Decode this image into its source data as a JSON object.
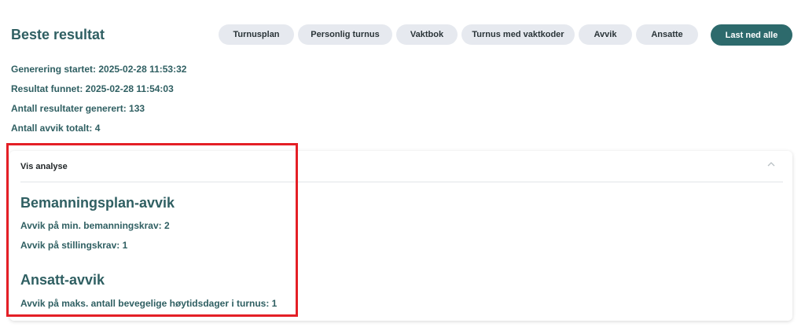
{
  "page_title": "Beste resultat",
  "tabs": [
    {
      "label": "Turnusplan"
    },
    {
      "label": "Personlig turnus"
    },
    {
      "label": "Vaktbok"
    },
    {
      "label": "Turnus med vaktkoder"
    },
    {
      "label": "Avvik"
    },
    {
      "label": "Ansatte"
    }
  ],
  "download_all_label": "Last ned alle",
  "info": {
    "generation_started": "Generering startet: 2025-02-28 11:53:32",
    "result_found": "Resultat funnet: 2025-02-28 11:54:03",
    "results_generated": "Antall resultater generert: 133",
    "total_deviations": "Antall avvik totalt: 4"
  },
  "analysis": {
    "toggle_label": "Vis analyse",
    "staffing_section": {
      "title": "Bemanningsplan-avvik",
      "rows": [
        "Avvik på min. bemanningskrav: 2",
        "Avvik på stillingskrav: 1"
      ]
    },
    "employee_section": {
      "title": "Ansatt-avvik",
      "rows": [
        "Avvik på maks. antall bevegelige høytidsdager i turnus: 1"
      ]
    }
  },
  "colors": {
    "accent": "#2d6a6c",
    "text": "#2f5f62",
    "highlight": "#e41f26",
    "tab_bg": "#e6e9ef"
  }
}
